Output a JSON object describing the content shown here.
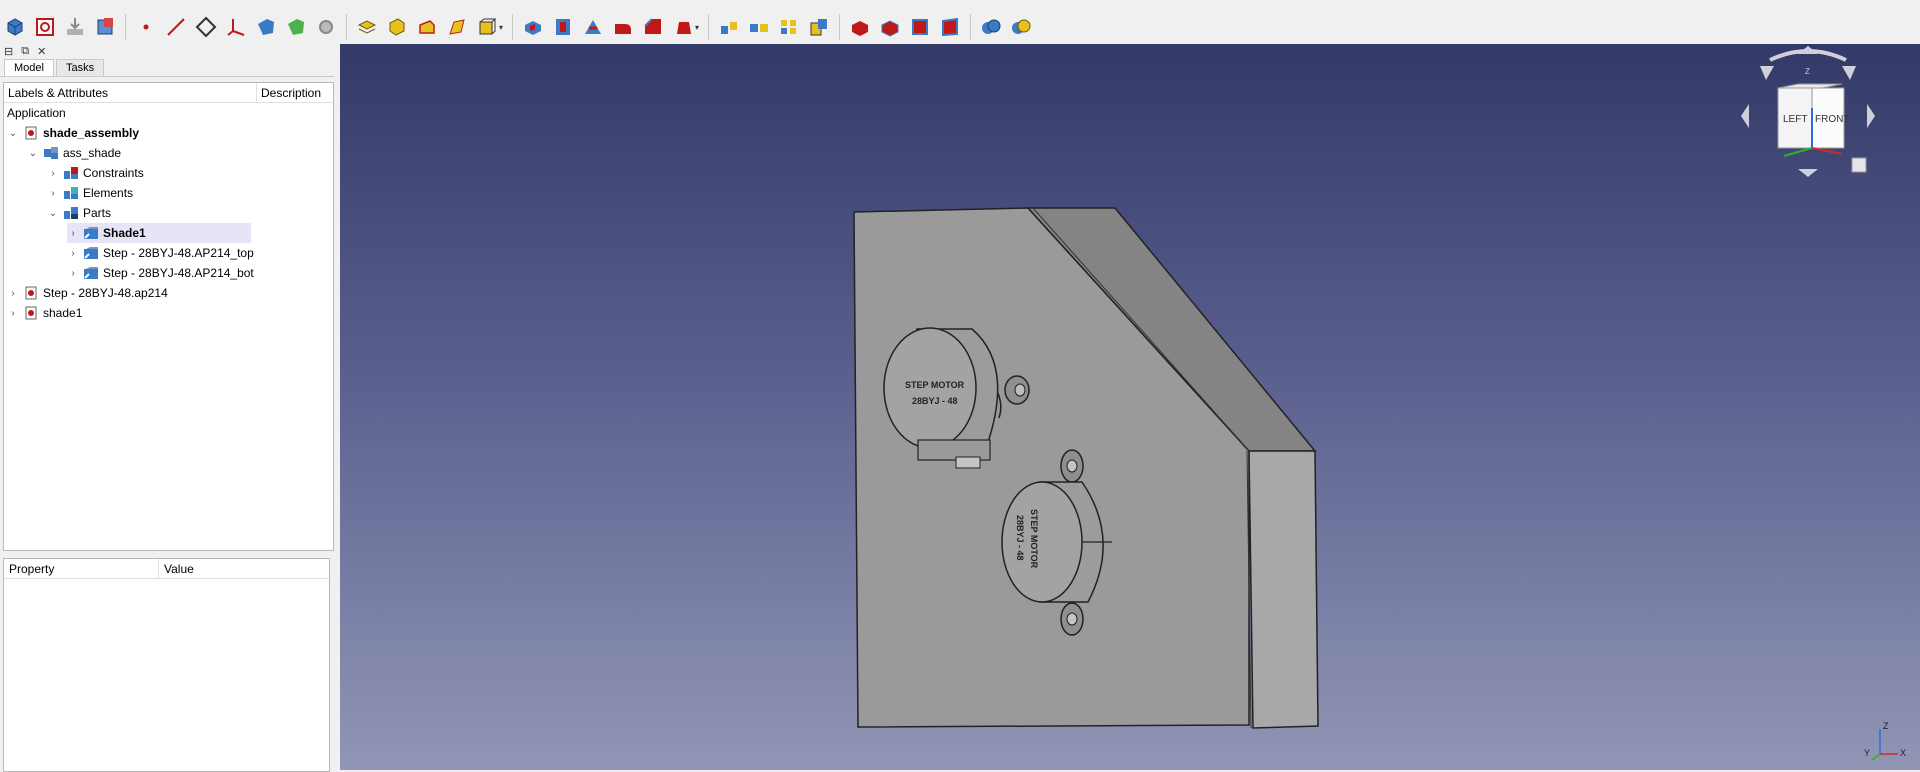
{
  "toolbar": {
    "icons": [
      "part-box-icon",
      "edit-plane-icon",
      "import-icon",
      "assembly-icon",
      "point-icon",
      "line-icon",
      "plane-icon",
      "axis-icon",
      "shape-icon",
      "sketch-shape-icon",
      "gear-icon",
      "solid-layer-icon",
      "extrude-icon",
      "revolve-icon",
      "sweep-icon",
      "block-icon",
      "pocket-icon",
      "hole-icon",
      "cut-icon",
      "fillet-icon",
      "chamfer-icon",
      "draft-icon",
      "pattern-icon",
      "mirror-icon",
      "array-icon",
      "multi-icon",
      "face-red-icon",
      "face-red2-icon",
      "face-red3-icon",
      "face-red4-icon",
      "boolean-icon",
      "boolean2-icon"
    ]
  },
  "combo": {
    "tabs": [
      "Model",
      "Tasks"
    ],
    "active_tab": "Model",
    "tree_columns": [
      "Labels & Attributes",
      "Description"
    ],
    "tree_section": "Application",
    "tree": [
      {
        "label": "shade_assembly",
        "bold": true,
        "expanded": true,
        "level": 0
      },
      {
        "label": "ass_shade",
        "expanded": true,
        "level": 1
      },
      {
        "label": "Constraints",
        "expanded": false,
        "level": 2
      },
      {
        "label": "Elements",
        "expanded": false,
        "level": 2
      },
      {
        "label": "Parts",
        "expanded": true,
        "level": 2
      },
      {
        "label": "Shade1",
        "bold": true,
        "selected": true,
        "expanded": false,
        "level": 3
      },
      {
        "label": "Step - 28BYJ-48.AP214_top",
        "expanded": false,
        "level": 3
      },
      {
        "label": "Step - 28BYJ-48.AP214_bot",
        "expanded": false,
        "level": 3
      },
      {
        "label": "Step - 28BYJ-48.ap214",
        "expanded": false,
        "level": 0
      },
      {
        "label": "shade1",
        "expanded": false,
        "level": 0
      }
    ],
    "property_columns": [
      "Property",
      "Value"
    ]
  },
  "viewport": {
    "navcube": {
      "left": "LEFT",
      "front": "FRONT",
      "top_axis": "Z"
    },
    "motor_label_line1": "STEP MOTOR",
    "motor_label_line2": "28BYJ - 48",
    "axis_labels": [
      "Z",
      "Y",
      "X"
    ]
  },
  "colors": {
    "bg_top": "#333a68",
    "bg_bottom": "#9196b6",
    "selection": "#e5e5f7"
  }
}
